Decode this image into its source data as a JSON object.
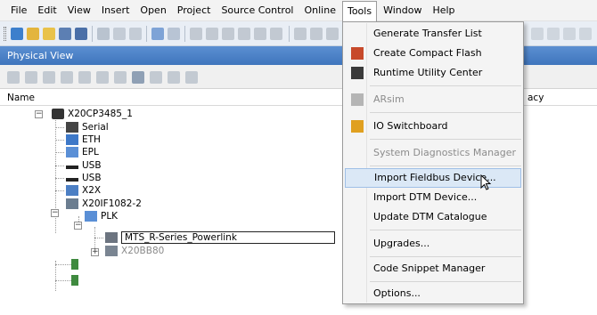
{
  "menubar": {
    "items": [
      "File",
      "Edit",
      "View",
      "Insert",
      "Open",
      "Project",
      "Source Control",
      "Online",
      "Tools",
      "Window",
      "Help"
    ],
    "active": "Tools"
  },
  "panel": {
    "title": "Physical View"
  },
  "columns": {
    "name": "Name",
    "right_partial": "acy"
  },
  "tree": {
    "root": "X20CP3485_1",
    "items": [
      "Serial",
      "ETH",
      "EPL",
      "USB",
      "USB",
      "X2X",
      "X20IF1082-2",
      "PLK"
    ],
    "edit_value": "MTS_R-Series_Powerlink",
    "greyed": "X20BB80"
  },
  "tools_menu": {
    "items": [
      "Generate Transfer List",
      "Create Compact Flash",
      "Runtime Utility Center",
      "ARsim",
      "IO Switchboard",
      "System Diagnostics Manager",
      "Import Fieldbus Device...",
      "Import DTM Device...",
      "Update DTM Catalogue",
      "Upgrades...",
      "Code Snippet Manager",
      "Options..."
    ],
    "hovered": "Import Fieldbus Device..."
  },
  "colors": {
    "panel_header": "#4a80c6",
    "menu_hover": "#dbe8f6",
    "toolbar_bg": "#e9eef5"
  }
}
